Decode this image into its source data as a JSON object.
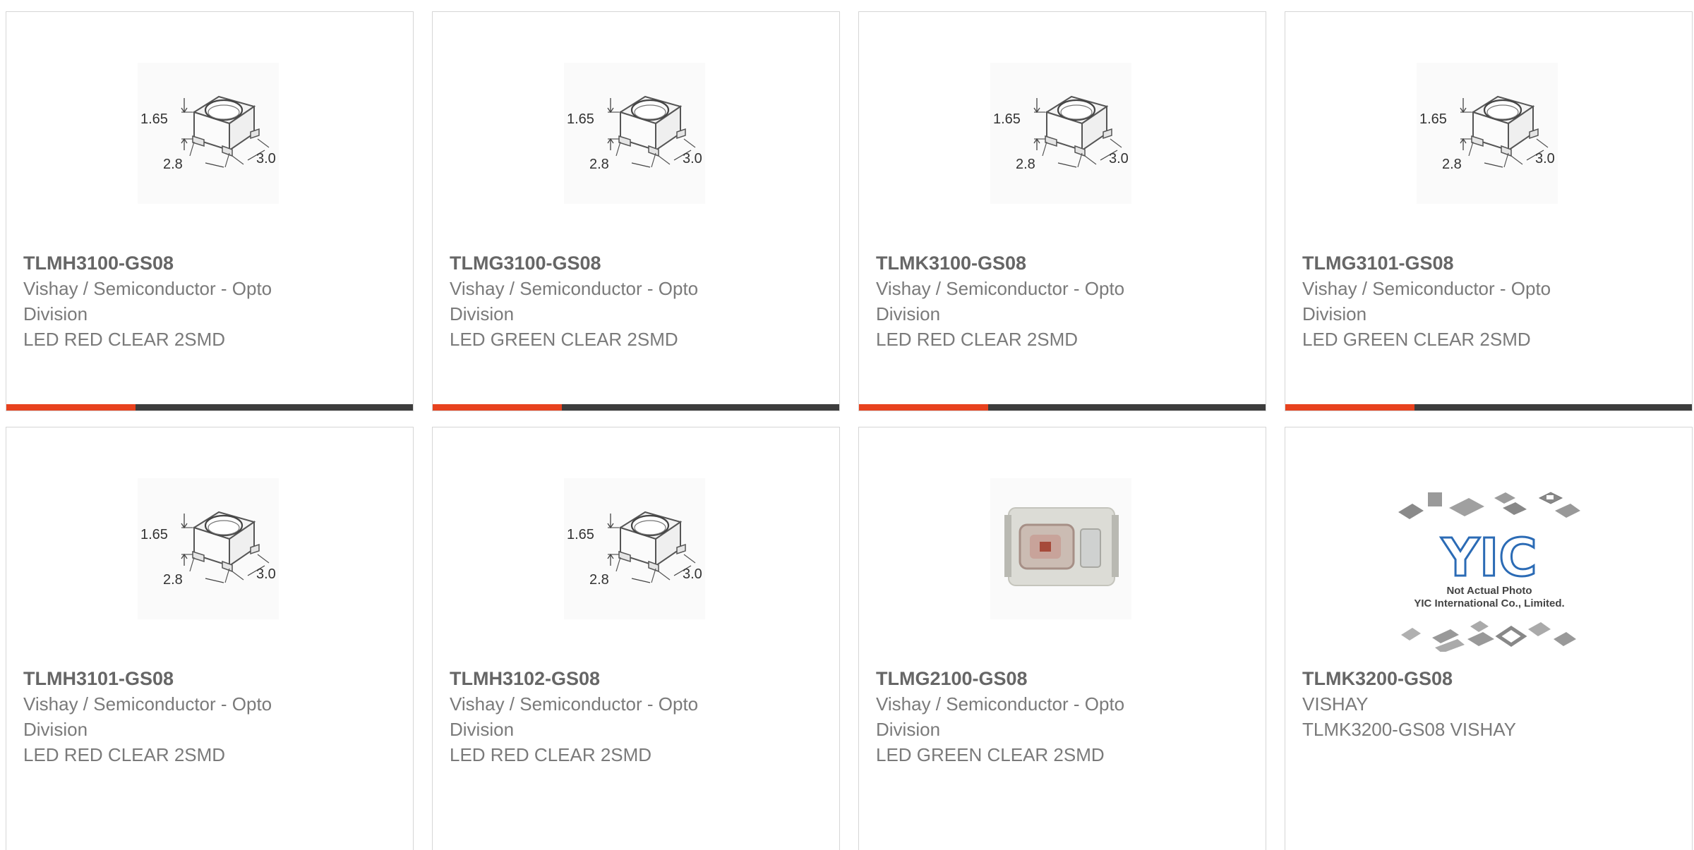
{
  "colors": {
    "accent": "#e8421e",
    "bar": "#3d3d3d",
    "border": "#d6d6d6",
    "text": "#7a7a7a"
  },
  "dimension_labels": {
    "height": "1.65",
    "width": "2.8",
    "depth": "3.0"
  },
  "yic_watermark": {
    "logo": "YIC",
    "line1": "Not Actual Photo",
    "line2": "YIC International Co., Limited."
  },
  "products": [
    {
      "part": "TLMH3100-GS08",
      "mfr_line1": "Vishay / Semiconductor - Opto",
      "mfr_line2": "Division",
      "desc": "LED RED CLEAR 2SMD",
      "image": "dimension-drawing"
    },
    {
      "part": "TLMG3100-GS08",
      "mfr_line1": "Vishay / Semiconductor - Opto",
      "mfr_line2": "Division",
      "desc": "LED GREEN CLEAR 2SMD",
      "image": "dimension-drawing"
    },
    {
      "part": "TLMK3100-GS08",
      "mfr_line1": "Vishay / Semiconductor - Opto",
      "mfr_line2": "Division",
      "desc": "LED RED CLEAR 2SMD",
      "image": "dimension-drawing"
    },
    {
      "part": "TLMG3101-GS08",
      "mfr_line1": "Vishay / Semiconductor - Opto",
      "mfr_line2": "Division",
      "desc": "LED GREEN CLEAR 2SMD",
      "image": "dimension-drawing"
    },
    {
      "part": "TLMH3101-GS08",
      "mfr_line1": "Vishay / Semiconductor - Opto",
      "mfr_line2": "Division",
      "desc": "LED RED CLEAR 2SMD",
      "image": "dimension-drawing"
    },
    {
      "part": "TLMH3102-GS08",
      "mfr_line1": "Vishay / Semiconductor - Opto",
      "mfr_line2": "Division",
      "desc": "LED RED CLEAR 2SMD",
      "image": "dimension-drawing"
    },
    {
      "part": "TLMG2100-GS08",
      "mfr_line1": "Vishay / Semiconductor - Opto",
      "mfr_line2": "Division",
      "desc": "LED GREEN CLEAR 2SMD",
      "image": "led-photo"
    },
    {
      "part": "TLMK3200-GS08",
      "mfr_line1": "VISHAY",
      "mfr_line2": "",
      "desc": "TLMK3200-GS08 VISHAY",
      "image": "yic-placeholder"
    }
  ]
}
